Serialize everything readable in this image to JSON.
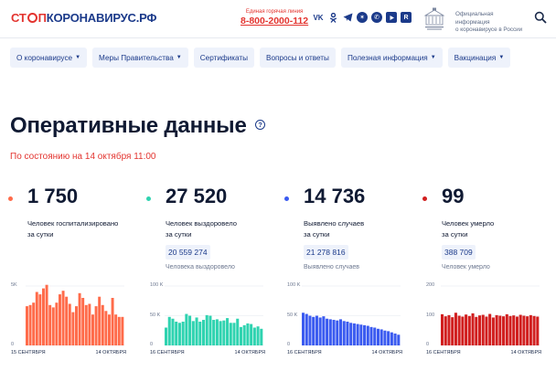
{
  "header": {
    "logo": {
      "part1": "СТ",
      "part2": "П",
      "part3": "КОРОНАВИРУС.РФ"
    },
    "hotline": {
      "label": "Единая горячая линия",
      "number": "8-800-2000-112"
    },
    "socials": [
      "vk-icon",
      "odnoklassniki-icon",
      "telegram-icon",
      "yandex-zen-icon",
      "viber-icon",
      "youtube-icon",
      "rutube-icon"
    ],
    "official_info": [
      "Официальная информация",
      "о коронавирусе в России"
    ]
  },
  "nav": [
    {
      "label": "О коронавирусе",
      "dropdown": true
    },
    {
      "label": "Меры Правительства",
      "dropdown": true
    },
    {
      "label": "Сертификаты",
      "dropdown": false
    },
    {
      "label": "Вопросы и ответы",
      "dropdown": false
    },
    {
      "label": "Полезная информация",
      "dropdown": true
    },
    {
      "label": "Вакцинация",
      "dropdown": true
    }
  ],
  "main": {
    "title": "Оперативные данные",
    "subtitle": "По состоянию на 14 октября 11:00"
  },
  "stats": [
    {
      "value": "1 750",
      "desc_line1": "Человек госпитализировано",
      "desc_line2": "за сутки",
      "total": "",
      "total_label": ""
    },
    {
      "value": "27 520",
      "desc_line1": "Человек выздоровело",
      "desc_line2": "за сутки",
      "total": "20 559 274",
      "total_label": "Человека выздоровело"
    },
    {
      "value": "14 736",
      "desc_line1": "Выявлено случаев",
      "desc_line2": "за сутки",
      "total": "21 278 816",
      "total_label": "Выявлено случаев"
    },
    {
      "value": "99",
      "desc_line1": "Человек умерло",
      "desc_line2": "за сутки",
      "total": "388 709",
      "total_label": "Человек умерло"
    }
  ],
  "colors": {
    "hospitalized": "#ff6b4a",
    "recovered": "#2fd3b0",
    "cases": "#3b5bf0",
    "deaths": "#d11f1f"
  },
  "chart_data": [
    {
      "type": "bar",
      "color": "#ff6b4a",
      "ymax": 5,
      "yticks": [
        {
          "value": 5,
          "label": "5K"
        },
        {
          "value": 0,
          "label": "0"
        }
      ],
      "start_label": "15 СЕНТЯБРЯ",
      "end_label": "14 ОКТЯБРЯ",
      "values": [
        3.3,
        3.4,
        3.6,
        4.5,
        4.3,
        4.8,
        5.1,
        3.4,
        3.2,
        3.6,
        4.3,
        4.6,
        4.1,
        3.5,
        2.8,
        3.3,
        4.4,
        4.0,
        3.4,
        3.5,
        2.6,
        3.3,
        4.1,
        3.4,
        2.9,
        2.6,
        4.0,
        2.6,
        2.4,
        2.4
      ]
    },
    {
      "type": "bar",
      "color": "#2fd3b0",
      "ymax": 100,
      "yticks": [
        {
          "value": 100,
          "label": "100 K"
        },
        {
          "value": 50,
          "label": "50 K"
        },
        {
          "value": 0,
          "label": "0"
        }
      ],
      "start_label": "16 СЕНТЯБРЯ",
      "end_label": "14 ОКТЯБРЯ",
      "values": [
        30,
        48,
        45,
        40,
        38,
        40,
        53,
        50,
        41,
        47,
        40,
        43,
        51,
        50,
        43,
        44,
        41,
        42,
        46,
        38,
        38,
        45,
        31,
        34,
        37,
        36,
        30,
        32,
        28
      ]
    },
    {
      "type": "bar",
      "color": "#3b5bf0",
      "ymax": 100,
      "yticks": [
        {
          "value": 100,
          "label": "100 K"
        },
        {
          "value": 50,
          "label": "50 K"
        },
        {
          "value": 0,
          "label": "0"
        }
      ],
      "start_label": "16 СЕНТЯБРЯ",
      "end_label": "14 ОКТЯБРЯ",
      "values": [
        55,
        53,
        50,
        48,
        50,
        47,
        49,
        45,
        44,
        43,
        42,
        44,
        41,
        40,
        38,
        37,
        36,
        35,
        34,
        33,
        31,
        30,
        28,
        27,
        25,
        24,
        22,
        20,
        18
      ]
    },
    {
      "type": "bar",
      "color": "#d11f1f",
      "ymax": 200,
      "yticks": [
        {
          "value": 200,
          "label": "200"
        },
        {
          "value": 100,
          "label": "100"
        },
        {
          "value": 0,
          "label": "0"
        }
      ],
      "start_label": "16 СЕНТЯБРЯ",
      "end_label": "14 ОКТЯБРЯ",
      "values": [
        105,
        98,
        102,
        95,
        110,
        100,
        97,
        104,
        99,
        108,
        96,
        101,
        103,
        97,
        106,
        94,
        102,
        100,
        98,
        105,
        99,
        101,
        97,
        103,
        100,
        98,
        102,
        99,
        97
      ]
    }
  ]
}
